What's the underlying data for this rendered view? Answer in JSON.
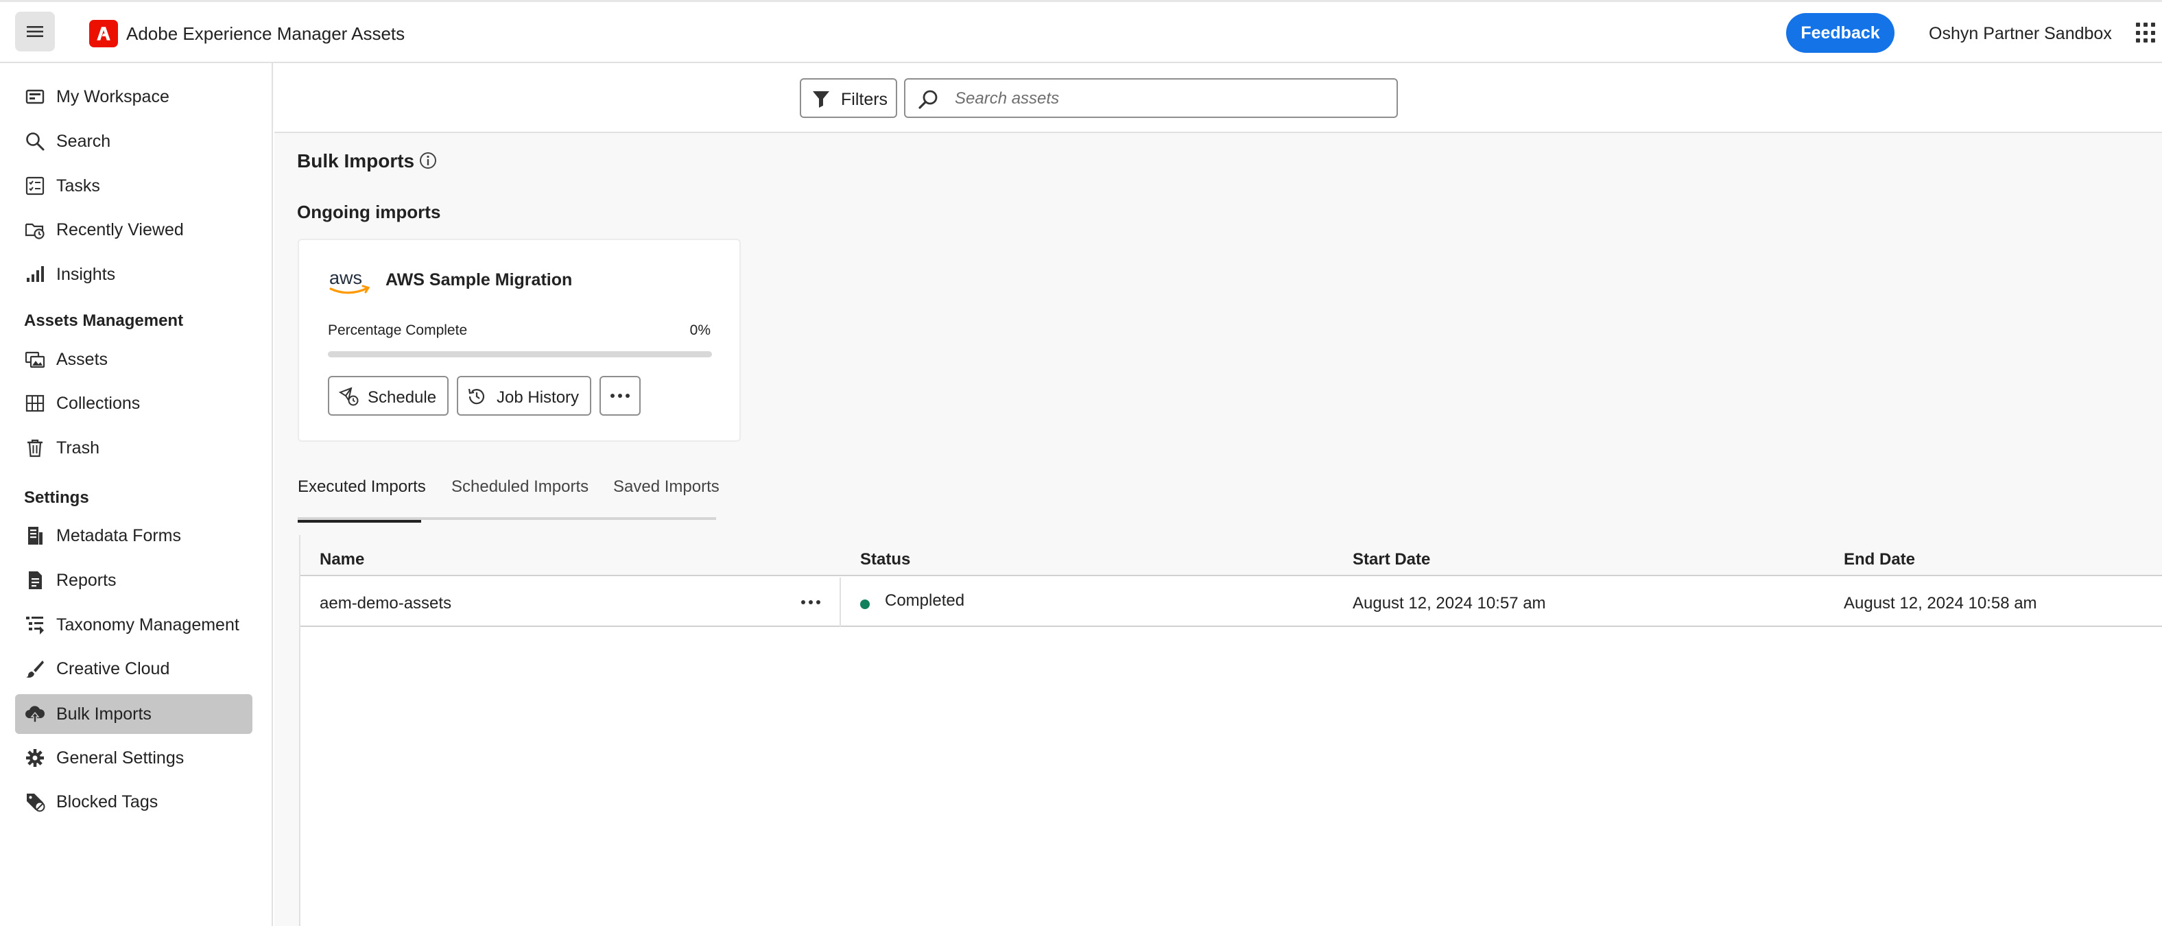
{
  "header": {
    "app_title": "Adobe Experience Manager Assets",
    "feedback_label": "Feedback",
    "org_name": "Oshyn Partner Sandbox"
  },
  "sidebar": {
    "items": [
      {
        "label": "My Workspace",
        "icon": "workspace-icon"
      },
      {
        "label": "Search",
        "icon": "search-icon"
      },
      {
        "label": "Tasks",
        "icon": "tasks-icon"
      },
      {
        "label": "Recently Viewed",
        "icon": "recent-folder-icon"
      },
      {
        "label": "Insights",
        "icon": "bar-chart-icon"
      }
    ],
    "section_assets_management": "Assets Management",
    "assets_items": [
      {
        "label": "Assets",
        "icon": "assets-icon"
      },
      {
        "label": "Collections",
        "icon": "collections-icon"
      },
      {
        "label": "Trash",
        "icon": "trash-icon"
      }
    ],
    "section_settings": "Settings",
    "settings_items": [
      {
        "label": "Metadata Forms",
        "icon": "metadata-forms-icon"
      },
      {
        "label": "Reports",
        "icon": "reports-icon"
      },
      {
        "label": "Taxonomy Management",
        "icon": "taxonomy-icon"
      },
      {
        "label": "Creative Cloud",
        "icon": "brush-icon"
      },
      {
        "label": "Bulk Imports",
        "icon": "cloud-upload-icon",
        "active": true
      },
      {
        "label": "General Settings",
        "icon": "gear-icon"
      },
      {
        "label": "Blocked Tags",
        "icon": "blocked-tag-icon"
      }
    ]
  },
  "toolbar": {
    "filters_label": "Filters",
    "search_placeholder": "Search assets"
  },
  "page": {
    "title": "Bulk Imports",
    "ongoing_title": "Ongoing imports"
  },
  "import_card": {
    "provider_logo": "aws",
    "title": "AWS Sample Migration",
    "progress_label": "Percentage Complete",
    "progress_value": "0%",
    "progress_fraction": 0,
    "schedule_label": "Schedule",
    "job_history_label": "Job History"
  },
  "tabs": [
    {
      "label": "Executed Imports",
      "selected": true
    },
    {
      "label": "Scheduled Imports"
    },
    {
      "label": "Saved Imports"
    }
  ],
  "table": {
    "columns": [
      "Name",
      "Status",
      "Start Date",
      "End Date"
    ],
    "rows": [
      {
        "name": "aem-demo-assets",
        "status": "Completed",
        "status_color": "#12805c",
        "start_date": "August 12, 2024 10:57 am",
        "end_date": "August 12, 2024 10:58 am"
      }
    ]
  },
  "colors": {
    "accent": "#1473e6",
    "adobe_red": "#eb1000",
    "active_nav": "#c6c6c6"
  }
}
